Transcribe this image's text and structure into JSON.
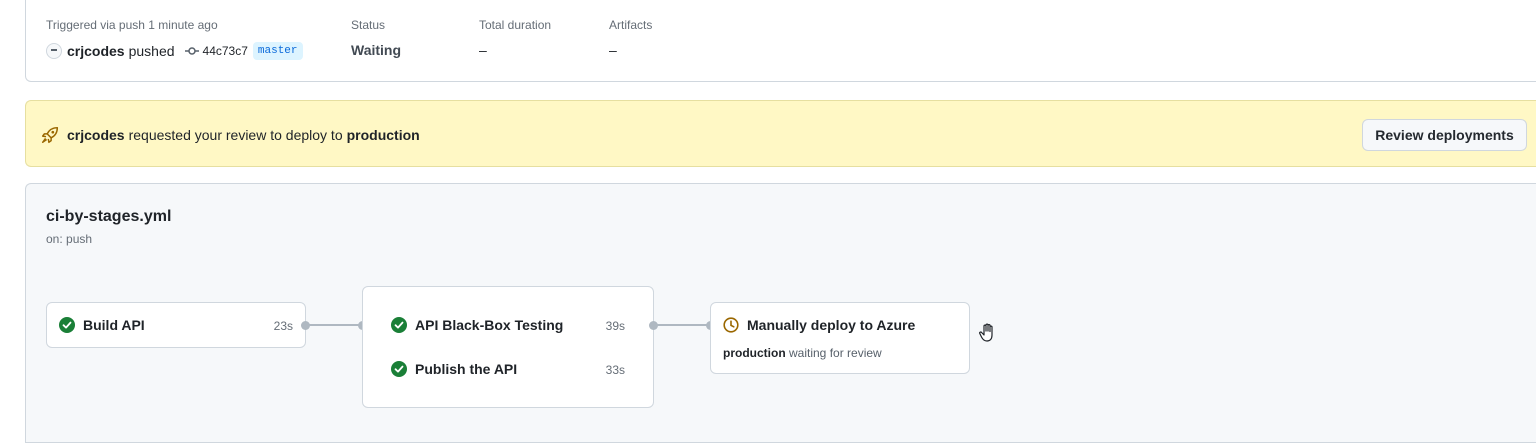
{
  "summary": {
    "triggered_label": "Triggered via push 1 minute ago",
    "actor": "crjcodes",
    "action": "pushed",
    "commit_sha": "44c73c7",
    "branch": "master",
    "status_label": "Status",
    "status_value": "Waiting",
    "duration_label": "Total duration",
    "duration_value": "–",
    "artifacts_label": "Artifacts",
    "artifacts_value": "–"
  },
  "banner": {
    "actor": "crjcodes",
    "message": "requested your review to deploy to",
    "environment": "production",
    "button_label": "Review deployments"
  },
  "workflow": {
    "name": "ci-by-stages.yml",
    "trigger": "on: push",
    "jobs": [
      {
        "name": "Build API",
        "duration": "23s",
        "status": "success"
      },
      {
        "name": "API Black-Box Testing",
        "duration": "39s",
        "status": "success"
      },
      {
        "name": "Publish the API",
        "duration": "33s",
        "status": "success"
      },
      {
        "name": "Manually deploy to Azure",
        "status": "waiting",
        "environment": "production",
        "waiting_text": "waiting for review"
      }
    ]
  },
  "colors": {
    "success": "#1a7f37",
    "waiting": "#9a6700",
    "banner_bg": "#fff8c5",
    "branch_fg": "#0969da",
    "branch_bg": "#ddf4ff"
  },
  "icons": {
    "actor_avatar": "avatar",
    "commit": "git-commit-icon",
    "banner": "rocket-icon",
    "success": "check-circle-icon",
    "waiting": "clock-icon",
    "cursor": "hand-cursor-icon"
  }
}
